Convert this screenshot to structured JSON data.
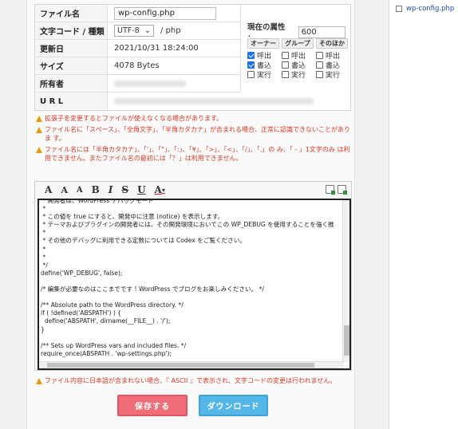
{
  "sidebar": {
    "file_label": "wp-config.php"
  },
  "info": {
    "filename_label": "ファイル名",
    "filename_value": "wp-config.php",
    "charset_label": "文字コード / 種類",
    "charset_value": "UTF-8",
    "charset_type": "/ php",
    "updated_label": "更新日",
    "updated_value": "2021/10/31 18:24:00",
    "size_label": "サイズ",
    "size_value": "4078  Bytes",
    "owner_label": "所有者",
    "url_label": "U R L"
  },
  "permission": {
    "current_label": "現在の属性 ：",
    "current_value": "600",
    "headers": [
      "オーナー",
      "グループ",
      "そのほか"
    ],
    "rows": [
      {
        "label": "呼出",
        "checked": [
          true,
          false,
          false
        ]
      },
      {
        "label": "書込",
        "checked": [
          true,
          false,
          false
        ]
      },
      {
        "label": "実行",
        "checked": [
          false,
          false,
          false
        ]
      }
    ]
  },
  "notes": [
    "拡張子を変更するとファイルが使えなくなる場合があります。",
    "ファイル名に「スペース」、「全角文字」、「半角カタカナ」が含まれる場合、正常に認識できないことがありま す。",
    "ファイル名には「半角カタカナ」、「'」、「\"」、「:」、「¥」、「>」、「<」、「/」、「.」の み、「 - 」1文字のみ は利用できません。またファイル名の最初には「？」は利用できません。"
  ],
  "toolbar": {
    "items": [
      "A",
      "A",
      "A",
      "B",
      "I",
      "S",
      "U",
      "A"
    ]
  },
  "code_lines": [
    " * 開発者は、WordPress デバッグモード",
    " *",
    " * この値を true にすると、開発中に注意 (notice) を表示します。",
    " * テーマおよびプラグインの開発者には、その開発環境においてこの WP_DEBUG を使用することを強く推",
    " *",
    " * その他のデバッグに利用できる定数については Codex をご覧ください。",
    " *",
    " * ",
    " */",
    "define('WP_DEBUG', false);",
    "",
    "/* 編集が必要なのはここまでです ! WordPress でブログをお楽しみください。 */",
    "",
    "/** Absolute path to the WordPress directory. */",
    "if ( !defined('ABSPATH') ) {",
    "  define('ABSPATH', dirname(__FILE__) . '/');",
    "}",
    "",
    "/** Sets up WordPress vars and included files. */",
    "require_once(ABSPATH . 'wp-settings.php');"
  ],
  "footer_note": "ファイル内容に日本語が含まれない場合、『 ASCII 』で表示され、文字コードの変更は行われません。",
  "buttons": {
    "save": "保存する",
    "download": "ダウンロード"
  }
}
